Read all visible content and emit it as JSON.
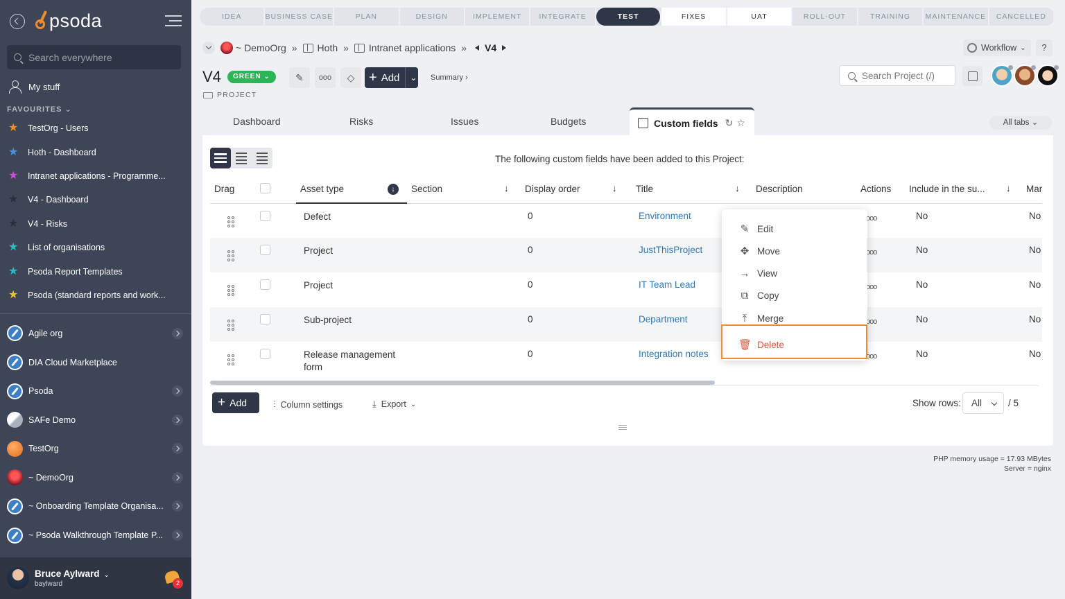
{
  "sidebar": {
    "logo": "psoda",
    "search_placeholder": "Search everywhere",
    "my_stuff": "My stuff",
    "favourites_label": "FAVOURITES",
    "favourites": [
      {
        "label": "TestOrg - Users",
        "color": "#f08c2c"
      },
      {
        "label": "Hoth - Dashboard",
        "color": "#4a8fe0"
      },
      {
        "label": "Intranet applications - Programme...",
        "color": "#d54bd6"
      },
      {
        "label": "V4 - Dashboard",
        "color": "#2a2f3a"
      },
      {
        "label": "V4 - Risks",
        "color": "#2a2f3a"
      },
      {
        "label": "List of organisations",
        "color": "#2fb9c9"
      },
      {
        "label": "Psoda Report Templates",
        "color": "#2fb9c9"
      },
      {
        "label": "Psoda (standard reports and work...",
        "color": "#e8c43a"
      }
    ],
    "organisations": [
      {
        "label": "Agile org",
        "icon": "compass",
        "chevron": true
      },
      {
        "label": "DIA Cloud Marketplace",
        "icon": "compass",
        "chevron": false
      },
      {
        "label": "Psoda",
        "icon": "compass",
        "chevron": true
      },
      {
        "label": "SAFe Demo",
        "icon": "safe",
        "chevron": true
      },
      {
        "label": "TestOrg",
        "icon": "orange",
        "chevron": true
      },
      {
        "label": "~ DemoOrg",
        "icon": "demo",
        "chevron": true
      },
      {
        "label": "~ Onboarding Template Organisa...",
        "icon": "compass",
        "chevron": true
      },
      {
        "label": "~ Psoda Walkthrough Template P...",
        "icon": "compass",
        "chevron": true
      }
    ],
    "user": {
      "name": "Bruce Aylward",
      "login": "baylward",
      "notifications": "2"
    }
  },
  "phases": [
    "IDEA",
    "BUSINESS CASE",
    "PLAN",
    "DESIGN",
    "IMPLEMENT",
    "INTEGRATE",
    "TEST",
    "FIXES",
    "UAT",
    "ROLL-OUT",
    "TRAINING",
    "MAINTENANCE",
    "CANCELLED"
  ],
  "active_phase": "TEST",
  "breadcrumb": {
    "org": "~ DemoOrg",
    "programme": "Hoth",
    "subprogramme": "Intranet applications",
    "project": "V4",
    "sep": "»"
  },
  "workflow_label": "Workflow",
  "help_label": "?",
  "title": "V4",
  "rag_status": "GREEN",
  "project_type": "PROJECT",
  "add_label": "Add",
  "summary_label": "Summary ›",
  "search_project_placeholder": "Search Project (/)",
  "tabs": [
    "Dashboard",
    "Risks",
    "Issues",
    "Budgets"
  ],
  "active_tab": "Custom fields",
  "all_tabs_label": "All tabs",
  "intro_text": "The following custom fields have been added to this Project:",
  "table": {
    "headers": [
      "Drag",
      "Asset type",
      "Section",
      "Display order",
      "Title",
      "Description",
      "Actions",
      "Include in the su...",
      "Mar"
    ],
    "rows": [
      {
        "asset_type": "Defect",
        "section": "",
        "display_order": "0",
        "title": "Environment",
        "include": "No",
        "mar": "No"
      },
      {
        "asset_type": "Project",
        "section": "",
        "display_order": "0",
        "title": "JustThisProject",
        "include": "No",
        "mar": "No"
      },
      {
        "asset_type": "Project",
        "section": "",
        "display_order": "0",
        "title": "IT Team Lead",
        "include": "No",
        "mar": "No"
      },
      {
        "asset_type": "Sub-project",
        "section": "",
        "display_order": "0",
        "title": "Department",
        "include": "No",
        "mar": "No"
      },
      {
        "asset_type": "Release management form",
        "section": "",
        "display_order": "0",
        "title": "Integration notes",
        "include": "No",
        "mar": "No"
      }
    ]
  },
  "bottom": {
    "add": "Add",
    "column_settings": "Column settings",
    "export": "Export",
    "show_rows": "Show rows:",
    "rows_value": "All",
    "rows_total": "/ 5"
  },
  "context_menu": [
    "Edit",
    "Move",
    "View",
    "Copy",
    "Merge",
    "Delete"
  ],
  "footer": {
    "memory": "PHP memory usage = 17.93 MBytes",
    "server": "Server = nginx"
  }
}
